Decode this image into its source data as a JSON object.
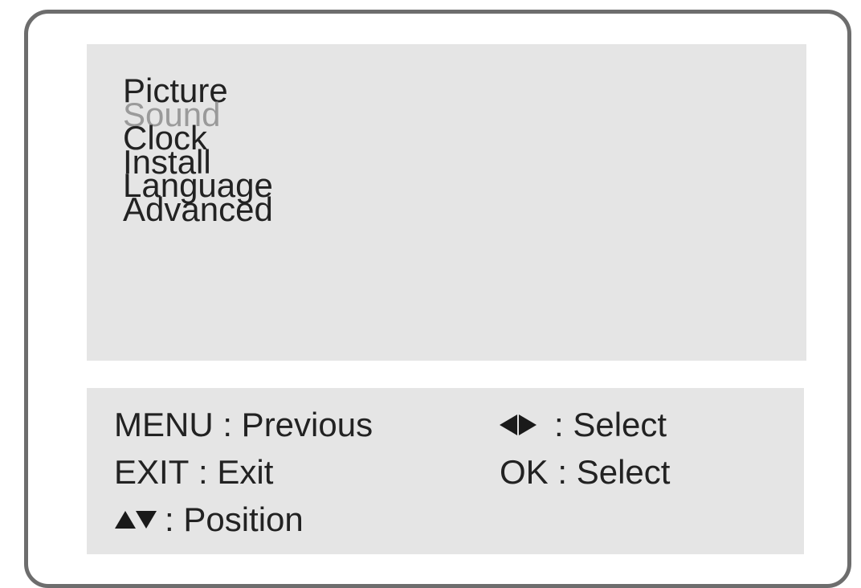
{
  "menu": {
    "items": [
      {
        "label": "Picture",
        "state": "normal"
      },
      {
        "label": "Sound",
        "state": "dimmed"
      },
      {
        "label": "Clock",
        "state": "normal"
      },
      {
        "label": "Install",
        "state": "normal"
      },
      {
        "label": "Language",
        "state": "normal"
      },
      {
        "label": "Advanced",
        "state": "normal"
      }
    ]
  },
  "help": {
    "menu_key": "MENU",
    "menu_action": ": Previous",
    "exit_key": "EXIT",
    "exit_action": ": Exit",
    "position_icon": "up-down-arrows-icon",
    "position_action": ": Position",
    "select_icon": "left-right-arrows-icon",
    "select_action": ": Select",
    "ok_key": "OK",
    "ok_action": ": Select"
  },
  "colors": {
    "panel_bg": "#e5e5e5",
    "frame_border": "#6d6d6d",
    "text": "#222222",
    "dimmed_text": "#9a9a9a"
  }
}
